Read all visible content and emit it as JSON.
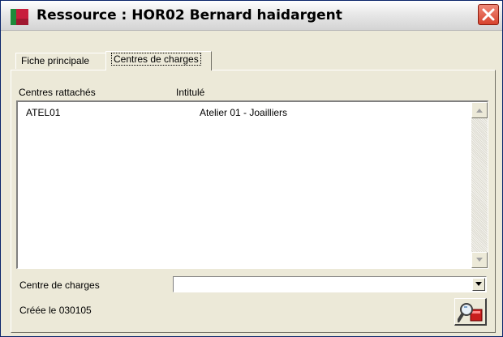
{
  "window": {
    "title": "Ressource : HOR02 Bernard haidargent"
  },
  "tabs": [
    {
      "label": "Fiche principale",
      "active": false
    },
    {
      "label": "Centres de charges",
      "active": true
    }
  ],
  "list": {
    "columns": [
      "Centres rattachés",
      "Intitulé"
    ],
    "rows": [
      {
        "code": "ATEL01",
        "label": "Atelier 01 - Joailliers"
      }
    ]
  },
  "form": {
    "centre_label": "Centre de charges",
    "centre_value": "",
    "created_text": "Créée le 030105"
  },
  "icons": {
    "app": "app-icon",
    "close": "close-icon",
    "action": "search-card-icon"
  },
  "colors": {
    "close_button": "#D8432E",
    "window_bg": "#ECE9D8"
  }
}
